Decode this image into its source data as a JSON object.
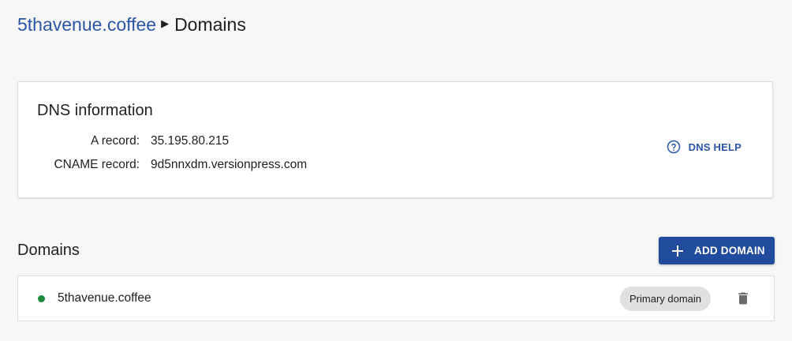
{
  "breadcrumb": {
    "site": "5thavenue.coffee",
    "separator": "▶",
    "current": "Domains"
  },
  "dns_card": {
    "title": "DNS information",
    "rows": [
      {
        "label": "A record:",
        "value": "35.195.80.215"
      },
      {
        "label": "CNAME record:",
        "value": "9d5nnxdm.versionpress.com"
      }
    ],
    "help_label": "DNS HELP",
    "help_icon": "help-circle-icon"
  },
  "domains": {
    "heading": "Domains",
    "add_button_label": "ADD DOMAIN",
    "add_icon": "plus-icon",
    "items": [
      {
        "name": "5thavenue.coffee",
        "status": "active",
        "badge": "Primary domain",
        "delete_icon": "trash-icon"
      }
    ]
  },
  "colors": {
    "accent": "#2b56a8",
    "button": "#214b9d",
    "status_active": "#1e8c3e",
    "chip_bg": "#e0e0e0",
    "background": "#f7f7f7"
  }
}
